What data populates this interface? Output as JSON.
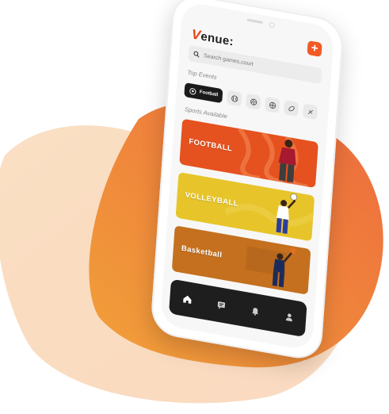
{
  "app": {
    "logo_initial": "V",
    "logo_rest": "enue:"
  },
  "header": {
    "add_button_label": "+"
  },
  "search": {
    "placeholder": "Search games,court"
  },
  "top_events": {
    "heading": "Top Events",
    "chips": [
      {
        "label": "Football",
        "icon": "football-icon",
        "active": true
      },
      {
        "icon": "tennis-ball-icon"
      },
      {
        "icon": "volleyball-icon"
      },
      {
        "icon": "basketball-icon"
      },
      {
        "icon": "rugby-ball-icon"
      },
      {
        "icon": "shuttlecock-icon"
      }
    ]
  },
  "sports": {
    "heading": "Sports Available",
    "cards": [
      {
        "title": "FOOTBALL",
        "color": "#e5521f"
      },
      {
        "title": "VOLLEYBALL",
        "color": "#e7c52a"
      },
      {
        "title": "Basketball",
        "color": "#c4701f"
      }
    ]
  },
  "nav": {
    "items": [
      {
        "icon": "home-icon"
      },
      {
        "icon": "chat-icon"
      },
      {
        "icon": "bell-icon"
      },
      {
        "icon": "profile-icon"
      }
    ]
  },
  "colors": {
    "accent": "#f15a24",
    "blob_start": "#f0a14a",
    "blob_end": "#f0703a"
  }
}
